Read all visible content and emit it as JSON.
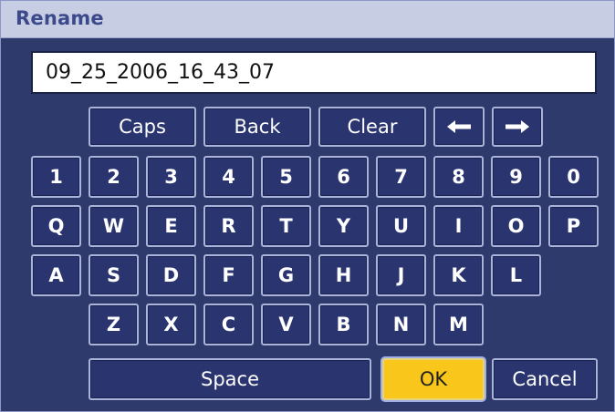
{
  "dialog": {
    "title": "Rename"
  },
  "name_field": {
    "value": "09_25_2006_16_43_07"
  },
  "top_keys": {
    "caps": "Caps",
    "back": "Back",
    "clear": "Clear",
    "left_icon": "left-arrow-icon",
    "right_icon": "right-arrow-icon"
  },
  "rows": {
    "digits": [
      "1",
      "2",
      "3",
      "4",
      "5",
      "6",
      "7",
      "8",
      "9",
      "0"
    ],
    "qwerty": [
      "Q",
      "W",
      "E",
      "R",
      "T",
      "Y",
      "U",
      "I",
      "O",
      "P"
    ],
    "asdf": [
      "A",
      "S",
      "D",
      "F",
      "G",
      "H",
      "J",
      "K",
      "L"
    ],
    "zxcv": [
      "Z",
      "X",
      "C",
      "V",
      "B",
      "N",
      "M"
    ]
  },
  "bottom_keys": {
    "space": "Space",
    "ok": "OK",
    "cancel": "Cancel"
  },
  "colors": {
    "background": "#2f3a6c",
    "titlebar": "#c7cde3",
    "title_text": "#3c4a8c",
    "ok_highlight": "#f9c61b"
  }
}
